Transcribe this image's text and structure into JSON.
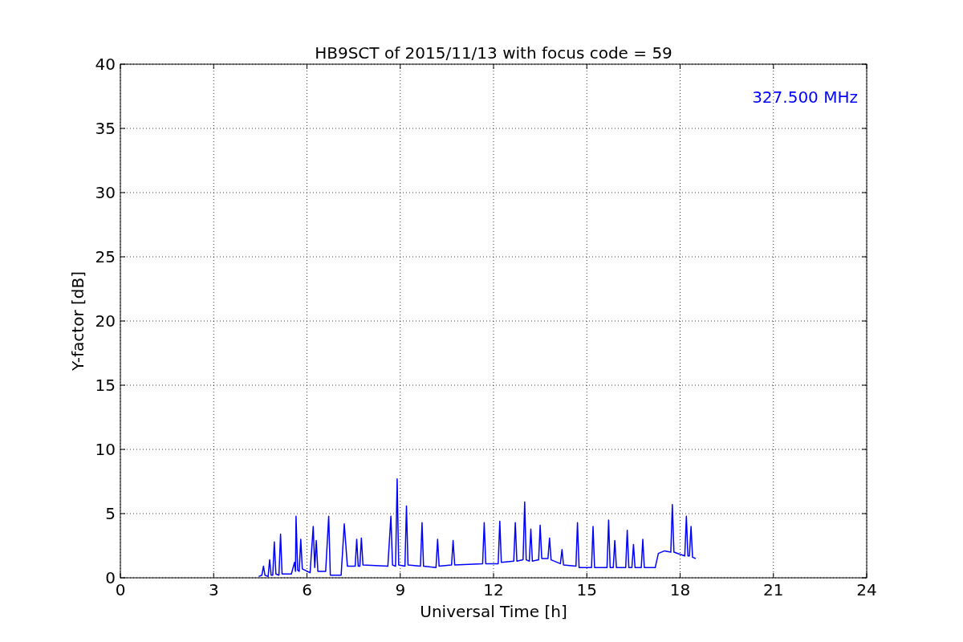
{
  "chart_data": {
    "type": "line",
    "title": "HB9SCT of 2015/11/13 with focus code = 59",
    "xlabel": "Universal Time [h]",
    "ylabel": "Y-factor [dB]",
    "xlim": [
      0,
      24
    ],
    "ylim": [
      0,
      40
    ],
    "xticks": [
      0,
      3,
      6,
      9,
      12,
      15,
      18,
      21,
      24
    ],
    "yticks": [
      0,
      5,
      10,
      15,
      20,
      25,
      30,
      35,
      40
    ],
    "grid": true,
    "x": [
      4.45,
      4.55,
      4.6,
      4.65,
      4.75,
      4.8,
      4.85,
      4.9,
      4.95,
      5.0,
      5.1,
      5.15,
      5.2,
      5.5,
      5.6,
      5.63,
      5.65,
      5.7,
      5.75,
      5.8,
      5.85,
      6.1,
      6.2,
      6.25,
      6.3,
      6.35,
      6.6,
      6.7,
      6.75,
      7.1,
      7.2,
      7.3,
      7.55,
      7.6,
      7.65,
      7.7,
      7.75,
      7.8,
      8.6,
      8.7,
      8.75,
      8.85,
      8.9,
      8.95,
      9.15,
      9.2,
      9.25,
      9.65,
      9.7,
      9.75,
      10.15,
      10.2,
      10.25,
      10.65,
      10.7,
      10.75,
      11.65,
      11.7,
      11.75,
      12.15,
      12.2,
      12.25,
      12.65,
      12.7,
      12.75,
      12.95,
      13.0,
      13.05,
      13.15,
      13.2,
      13.25,
      13.45,
      13.5,
      13.55,
      13.75,
      13.8,
      13.85,
      14.15,
      14.2,
      14.25,
      14.65,
      14.7,
      14.75,
      15.15,
      15.2,
      15.25,
      15.65,
      15.7,
      15.75,
      15.85,
      15.9,
      15.95,
      16.25,
      16.3,
      16.35,
      16.45,
      16.5,
      16.55,
      16.75,
      16.8,
      16.85,
      17.2,
      17.3,
      17.5,
      17.7,
      17.75,
      17.8,
      18.15,
      18.2,
      18.25,
      18.3,
      18.35,
      18.4,
      18.5
    ],
    "series": [
      {
        "name": "327.500 MHz",
        "color": "#0000ff",
        "values": [
          0.1,
          0.2,
          0.9,
          0.2,
          0.1,
          1.4,
          0.2,
          0.2,
          2.8,
          0.3,
          0.2,
          3.4,
          0.3,
          0.3,
          1.2,
          0.5,
          4.8,
          0.6,
          0.5,
          3.0,
          0.7,
          0.4,
          4.0,
          0.8,
          2.9,
          0.5,
          0.5,
          4.8,
          0.2,
          0.2,
          4.2,
          0.9,
          0.9,
          3.0,
          0.9,
          0.9,
          3.1,
          1.0,
          0.9,
          4.8,
          1.0,
          0.9,
          7.7,
          1.0,
          0.9,
          5.6,
          1.0,
          0.9,
          4.3,
          0.9,
          0.8,
          3.0,
          0.9,
          1.0,
          2.9,
          1.0,
          1.1,
          4.3,
          1.1,
          1.1,
          4.4,
          1.2,
          1.3,
          4.3,
          1.3,
          1.4,
          5.9,
          1.4,
          1.3,
          3.8,
          1.3,
          1.4,
          4.1,
          1.5,
          1.5,
          3.1,
          1.4,
          1.1,
          2.2,
          1.0,
          0.9,
          4.3,
          0.8,
          0.8,
          4.0,
          0.8,
          0.8,
          4.5,
          0.8,
          0.8,
          2.9,
          0.8,
          0.8,
          3.7,
          0.8,
          0.8,
          2.6,
          0.8,
          0.8,
          3.0,
          0.8,
          0.8,
          1.9,
          2.1,
          2.0,
          5.7,
          2.0,
          1.7,
          4.8,
          1.7,
          1.7,
          4.0,
          1.6,
          1.5
        ]
      }
    ]
  }
}
